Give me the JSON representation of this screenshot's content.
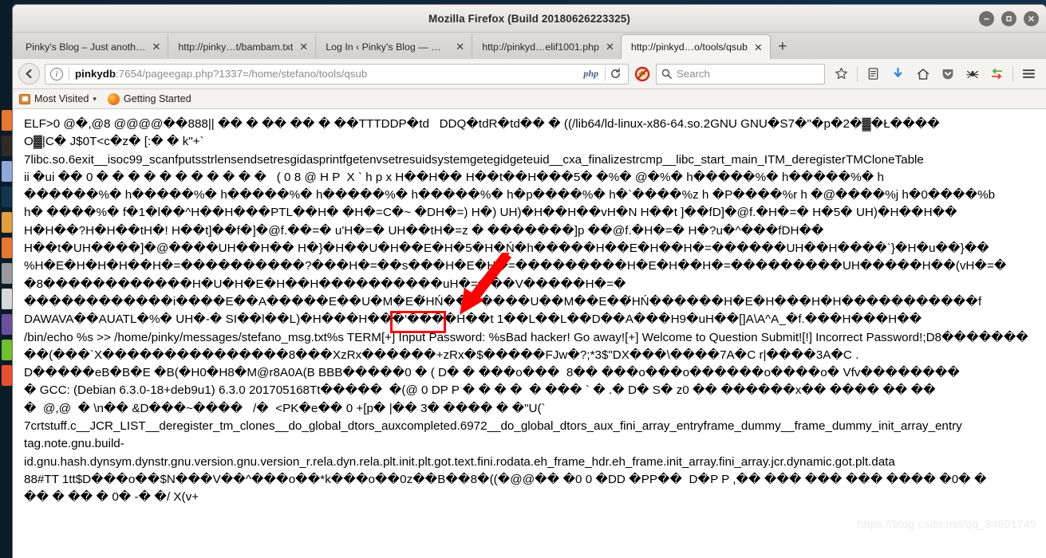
{
  "window": {
    "title": "Mozilla Firefox (Build 20180626223325)",
    "controls": {
      "minimize": "minimize-button",
      "maximize": "maximize-button",
      "close": "close-button"
    }
  },
  "tabs": [
    {
      "label": "Pinky's Blog – Just anoth…",
      "close": "✕",
      "active": false
    },
    {
      "label": "http://pinky…t/bambam.txt",
      "close": "✕",
      "active": false
    },
    {
      "label": "Log In ‹ Pinky's Blog — W…",
      "close": "✕",
      "active": false
    },
    {
      "label": "http://pinkyd…elif1001.php",
      "close": "✕",
      "active": false
    },
    {
      "label": "http://pinkyd…o/tools/qsub",
      "close": "✕",
      "active": true
    }
  ],
  "new_tab_label": "+",
  "navbar": {
    "back_label": "←",
    "url_host": "pinkydb",
    "url_rest": ":7654/pageegap.php?1337=/home/stefano/tools/qsub",
    "url_full": "pinkydb:7654/pageegap.php?1337=/home/stefano/tools/qsub",
    "php_badge": "php",
    "reload_label": "↻",
    "search_placeholder": "Search",
    "icons": [
      "bookmark-star-icon",
      "reader-list-icon",
      "downloads-icon",
      "home-icon",
      "pocket-shield-icon",
      "spider-icon",
      "sync-arrows-icon",
      "hamburger-menu-icon"
    ]
  },
  "bookmarks": [
    {
      "label": "Most Visited",
      "icon": "bookmark-folder-icon",
      "caret": "▾"
    },
    {
      "label": "Getting Started",
      "icon": "firefox-icon",
      "caret": ""
    }
  ],
  "content": {
    "binary_dump": "ELF>0 @�,@8 @@@@��888|| �� � �� �� � ��TTTDDP�td   DDQ�tdR�td�� � ((/lib64/ld-linux-x86-64.so.2GNU GNU�S7�\"�p�2�▓�Ł����\nO▓|C� J$0T<c�z� [:� � k\"+`\n7libc.so.6exit__isoc99_scanfputsstrlensendsetresgidasprintfgetenvsetresuidsystemgetegidgeteuid__cxa_finalizestrcmp__libc_start_main_ITM_deregisterTMCloneTable\nii �ui �� 0 � � � � � � � � � � �   ( 0 8 @ H P  X ` h p x H��H�� H��t��H���5� �%� @�%� h�����%� h�����%� h\n������%� h�����%� h�����%� h�����%� h�����%� h�p����%� h�`����%z h �P����%r h �@����%j h�0����%b\nh� ����%� f�1�l��^H��H���PTL��H� �H�=C�~ �DH�=) H�) UH)�H��H��vH�N H��t ]��fD]�@f.�H�=� H�5� UH)�H��H��\nH�H��?H�H��tH�! H��t]��f�]�@f.��=� u'H�=� UH��tH�=z � �������]p ��@f.�H�=� H�?u�^���fDH��\nH��t�UH����]�@����UH��H�� H�}�H��U�H��E�H�5�H�Ń�h�����H��E�H��H�=������UH��H����`}�H�u��}��\n%H�E�H�H�H��H�=����������?���H�=��s���H�E�H�=���������H�E�H��H�=���������UH�����H��(vH�=�\n�8������������H�U�H�E�H��H����������uH�=���V�����H�=�\n������������i����E��A�����E��U�M�E�́HŃ�������U��M��E��́HŃ������H�E�H���H�H�����������f\nDAWAVA��AUATL�%� UH�-� SI��l��L)�H���H���'����H��t 1��L��L��D��A���H9�uH��[]A\\A^A_�f.���H���H��\n/bin/echo %s >> /home/pinky/messages/stefano_msg.txt%s TERM[+] Input Password: %sBad hacker! Go away![+] Welcome to Question Submit![!] Incorrect Password!;D8���������(���`X���������������8���XzRx������+zRx�$�����FJw�?;*3$\"DX���\\����7A�C r|����3A�C .\nD�����eB�B�E �B(�H0�H8�M@r8A0A(B BBB�����0 � ( D� � ���o���  8�� ���o���o������o����o� Vfv��������\n� GCC: (Debian 6.3.0-18+deb9u1) 6.3.0 201705168Tt�����  �(@ 0 DP P � � � �  � ��� ` � .� D� S� z0 �� ������x�� ���� �� ��\n�  @,@  � \\n�� &D���~����   /�  <PK�e�� 0 +[p� |�� 3� ���� � �\"U(`\n7crtstuff.c__JCR_LIST__deregister_tm_clones__do_global_dtors_auxcompleted.6972__do_global_dtors_aux_fini_array_entryframe_dummy__frame_dummy_init_array_entry\ntag.note.gnu.build-\nid.gnu.hash.dynsym.dynstr.gnu.version.gnu.version_r.rela.dyn.rela.plt.init.plt.got.text.fini.rodata.eh_frame_hdr.eh_frame.init_array.fini_array.jcr.dynamic.got.plt.data\n88#TT 1tt$D���o��$N���V��^���o��*k���o��0z��B��8�((�@@�� �0 0 �DD �PP��  D�P P ,�� ��� ��� ��� ���� �0� �\n�� � �� � 0� -� �/ X(v+",
    "highlighted_text": "s TERM[+",
    "watermark": "https://blog.csdn.net/qq_34801745"
  },
  "annotations": {
    "box_color": "#ff0000",
    "arrow_color": "#ff0000",
    "box_name": "red-highlight-box",
    "arrow_name": "red-pointer-arrow"
  },
  "dock": {
    "items": [
      {
        "name": "dock-item-1",
        "color": "#e8762d"
      },
      {
        "name": "dock-item-2",
        "color": "#2f2a26"
      },
      {
        "name": "dock-item-3",
        "color": "#8fa8dc"
      },
      {
        "name": "dock-item-4",
        "color": "#123752"
      },
      {
        "name": "dock-item-5",
        "color": "#e0a03a"
      },
      {
        "name": "dock-item-6",
        "color": "#e8762d"
      },
      {
        "name": "dock-item-7",
        "color": "#9a9a9a"
      },
      {
        "name": "dock-item-8",
        "color": "#d8d8d8"
      },
      {
        "name": "dock-item-9",
        "color": "#6b4fa0"
      },
      {
        "name": "dock-item-10",
        "color": "#6fc02c"
      },
      {
        "name": "dock-item-11",
        "color": "#e8502d"
      }
    ]
  }
}
